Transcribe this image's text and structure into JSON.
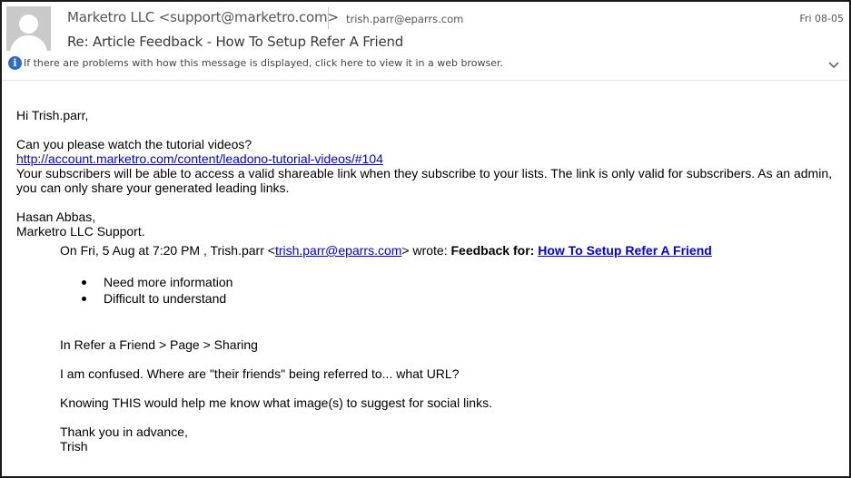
{
  "header": {
    "sender": "Marketro LLC <support@marketro.com>",
    "to": "trish.parr@eparrs.com",
    "date": "Fri 08-05",
    "subject": "Re: Article Feedback - How To Setup Refer A Friend",
    "info_bar": "If there are problems with how this message is displayed, click here to view it in a web browser.",
    "icons": [
      "avatar-placeholder",
      "info-icon",
      "chevron-down-icon"
    ]
  },
  "body": {
    "greeting": "Hi Trish.parr,",
    "question": "Can you please watch the tutorial videos?",
    "tutorial_link": "http://account.marketro.com/content/leadono-tutorial-videos/#104",
    "explanation": "Your subscribers will be able to access a valid shareable link when they subscribe to your lists. The link is only valid for subscribers. As an admin, you can only share your generated leading links.",
    "signature_name": "Hasan Abbas,",
    "signature_company": "Marketro LLC Support."
  },
  "quoted": {
    "intro_prefix": "On Fri, 5 Aug at 7:20 PM , Trish.parr <",
    "intro_email": "trish.parr@eparrs.com",
    "intro_suffix": "> wrote:",
    "feedback_label": "Feedback for:",
    "feedback_link": "How To Setup Refer A Friend",
    "bullets": [
      "Need more information",
      "Difficult to understand"
    ],
    "location": "In Refer a Friend > Page > Sharing",
    "confusion": "I am confused. Where are \"their friends\" being referred to... what URL?",
    "knowing": "Knowing THIS would help me know what image(s) to suggest for social links.",
    "thanks": "Thank you in advance,",
    "name": "Trish"
  }
}
